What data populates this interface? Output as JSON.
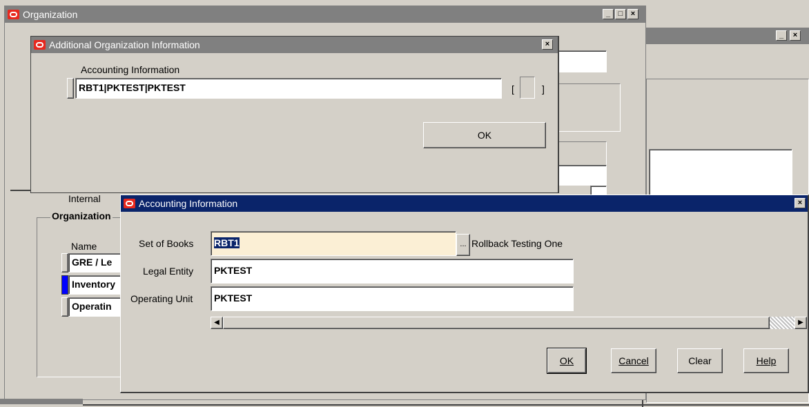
{
  "organization_window": {
    "title": "Organization",
    "internal_label": "Internal",
    "section_title": "Organization",
    "name_header": "Name",
    "rows": [
      "GRE / Le",
      "Inventory",
      "Operatin"
    ]
  },
  "additional_info_dialog": {
    "title": "Additional Organization Information",
    "prompt": "Accounting Information",
    "value": "RBT1|PKTEST|PKTEST",
    "bracket_open": "[",
    "bracket_close": "]",
    "ok_label": "OK"
  },
  "accounting_dialog": {
    "title": "Accounting Information",
    "set_of_books_label": "Set of Books",
    "set_of_books_value": "RBT1",
    "lov_button": "...",
    "set_of_books_desc": "Rollback Testing One",
    "legal_entity_label": "Legal Entity",
    "legal_entity_value": "PKTEST",
    "operating_unit_label": "Operating Unit",
    "operating_unit_value": "PKTEST",
    "buttons": {
      "ok": "OK",
      "cancel": "Cancel",
      "clear": "Clear",
      "help": "Help"
    },
    "accent_color": "#0a246a",
    "focus_field_color": "#fbefd5"
  },
  "icons": [
    "oracle-logo-icon",
    "minimize-icon",
    "maximize-icon",
    "close-icon",
    "scroll-left-icon",
    "scroll-right-icon"
  ]
}
